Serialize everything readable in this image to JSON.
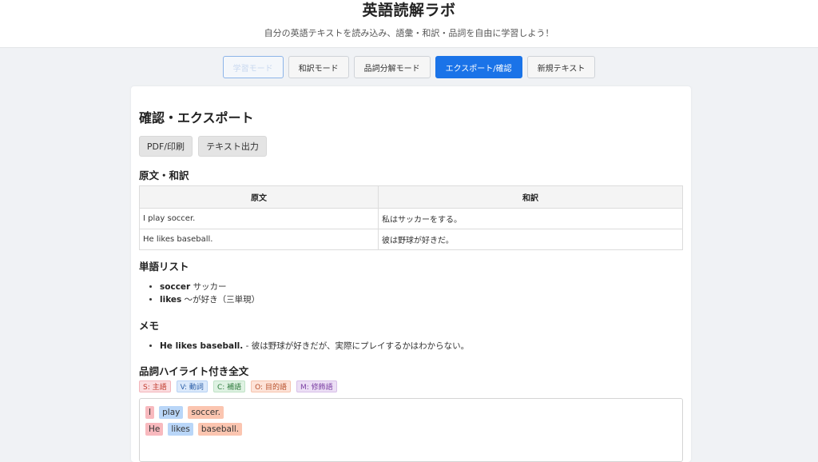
{
  "header": {
    "title": "英語読解ラボ",
    "subtitle": "自分の英語テキストを読み込み、語彙・和訳・品詞を自由に学習しよう！"
  },
  "tabs": [
    {
      "label": "学習モード"
    },
    {
      "label": "和訳モード"
    },
    {
      "label": "品詞分解モード"
    },
    {
      "label": "エクスポート/確認"
    },
    {
      "label": "新規テキスト"
    }
  ],
  "page": {
    "title": "確認・エクスポート",
    "pdf_button": "PDF/印刷",
    "text_button": "テキスト出力"
  },
  "translation": {
    "heading": "原文・和訳",
    "col_original": "原文",
    "col_translation": "和訳",
    "rows": [
      {
        "original": "I play soccer.",
        "translation": "私はサッカーをする。"
      },
      {
        "original": "He likes baseball.",
        "translation": "彼は野球が好きだ。"
      }
    ]
  },
  "vocab": {
    "heading": "単語リスト",
    "items": [
      {
        "word": "soccer",
        "meaning": "サッカー"
      },
      {
        "word": "likes",
        "meaning": "〜が好き（三単現）"
      }
    ]
  },
  "memo": {
    "heading": "メモ",
    "items": [
      {
        "sentence": "He likes baseball.",
        "note": "- 彼は野球が好きだが、実際にプレイするかはわからない。"
      }
    ]
  },
  "pos": {
    "heading": "品詞ハイライト付き全文",
    "legend": {
      "s": "S: 主語",
      "v": "V: 動詞",
      "c": "C: 補語",
      "o": "O: 目的語",
      "m": "M: 修飾語"
    },
    "lines": [
      [
        "I",
        "play",
        "soccer."
      ],
      [
        "He",
        "likes",
        "baseball."
      ]
    ]
  }
}
